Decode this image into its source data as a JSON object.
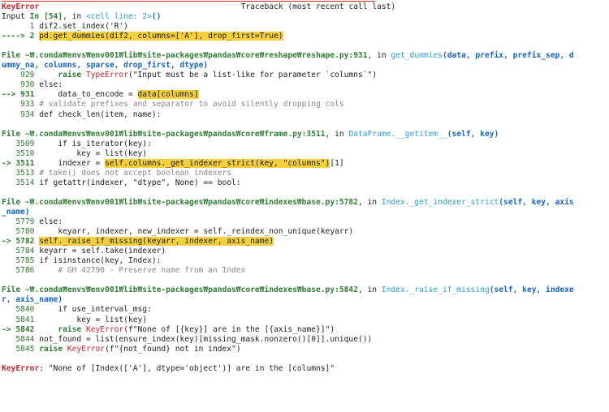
{
  "error_type": "KeyError",
  "traceback_header": "Traceback (most recent call last)",
  "input_label": "Input ",
  "input_in": "In [54]",
  "input_sep": ", in ",
  "input_cell": "<cell line: 2>",
  "input_paren": "()",
  "frames": [
    {
      "lines": [
        {
          "n": "      1 ",
          "code": "dif2.set_index('R')"
        },
        {
          "arrow": "----> 2 ",
          "hl": "pd.get_dummies(dif2, columns=['A'], drop_first=True)"
        }
      ]
    },
    {
      "file": "File ~₩.conda₩envs₩env001₩lib₩site-packages₩pandas₩core₩reshape₩reshape.py:931",
      "in": ", in ",
      "func": "get_dummies",
      "args": "(data, prefix, prefix_sep, dummy_na, columns, sparse, drop_first, dtype)",
      "lines": [
        {
          "n": "    929 ",
          "code": "    raise TypeError(\"Input must be a list-like for parameter `columns`\")"
        },
        {
          "n": "    930 ",
          "code": "else:"
        },
        {
          "arrow": "--> 931 ",
          "code": "    data_to_encode = ",
          "hl": "data[columns]"
        },
        {
          "n": "    933 ",
          "code": "# validate prefixes and separator to avoid silently dropping cols"
        },
        {
          "n": "    934 ",
          "code": "def check_len(item, name):"
        }
      ]
    },
    {
      "file": "File ~₩.conda₩envs₩env001₩lib₩site-packages₩pandas₩core₩frame.py:3511",
      "in": ", in ",
      "func": "DataFrame.__getitem__",
      "args": "(self, key)",
      "lines": [
        {
          "n": "   3509 ",
          "code": "    if is_iterator(key):"
        },
        {
          "n": "   3510 ",
          "code": "        key = list(key)"
        },
        {
          "arrow": "-> 3511 ",
          "code": "    indexer = ",
          "hl": "self.columns._get_indexer_strict(key, \"columns\")",
          "tail": "[1]"
        },
        {
          "n": "   3513 ",
          "code": "# take() does not accept boolean indexers"
        },
        {
          "n": "   3514 ",
          "code": "if getattr(indexer, \"dtype\", None) == bool:"
        }
      ]
    },
    {
      "file": "File ~₩.conda₩envs₩env001₩lib₩site-packages₩pandas₩core₩indexes₩base.py:5782",
      "in": ", in ",
      "func": "Index._get_indexer_strict",
      "args": "(self, key, axis_name)",
      "lines": [
        {
          "n": "   5779 ",
          "code": "else:"
        },
        {
          "n": "   5780 ",
          "code": "    keyarr, indexer, new_indexer = self._reindex_non_unique(keyarr)"
        },
        {
          "arrow": "-> 5782 ",
          "hl": "self._raise_if_missing(keyarr, indexer, axis_name)"
        },
        {
          "n": "   5784 ",
          "code": "keyarr = self.take(indexer)"
        },
        {
          "n": "   5785 ",
          "code": "if isinstance(key, Index):"
        },
        {
          "n": "   5786 ",
          "code": "    # GH 42790 - Preserve name from an Index"
        }
      ]
    },
    {
      "file": "File ~₩.conda₩envs₩env001₩lib₩site-packages₩pandas₩core₩indexes₩base.py:5842",
      "in": ", in ",
      "func": "Index._raise_if_missing",
      "args": "(self, key, indexer, axis_name)",
      "lines": [
        {
          "n": "   5840 ",
          "code": "    if use_interval_msg:"
        },
        {
          "n": "   5841 ",
          "code": "        key = list(key)"
        },
        {
          "arrow": "-> 5842 ",
          "code": "    raise KeyError(f\"None of [{key}] are in the [{axis_name}]\")"
        },
        {
          "n": "   5844 ",
          "code": "not_found = list(ensure_index(key)[missing_mask.nonzero()[0]].unique())"
        },
        {
          "n": "   5845 ",
          "code": "raise KeyError(f\"{not_found} not in index\")"
        }
      ]
    }
  ],
  "final_error_type": "KeyError",
  "final_message": ": \"None of [Index(['A'], dtype='object')] are in the [columns]\""
}
